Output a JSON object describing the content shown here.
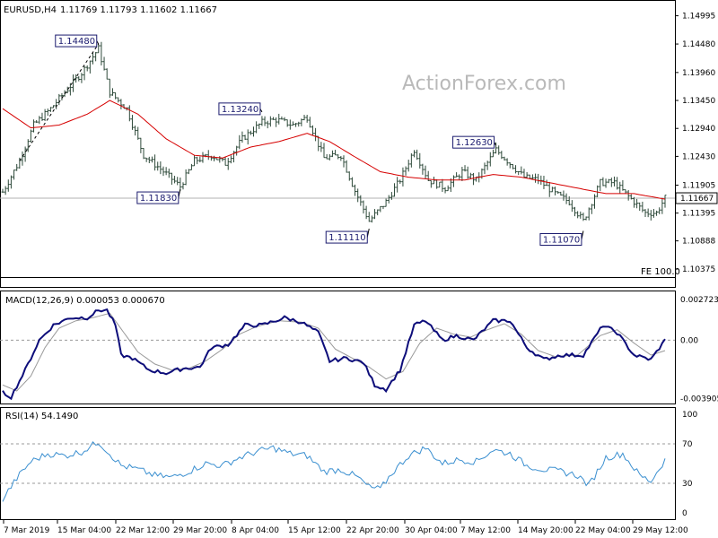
{
  "header": {
    "symbol": "EURUSD,H4",
    "ohlc": "1.11769 1.11793 1.11602 1.11667"
  },
  "watermark": "ActionForex.com",
  "fe_label": "FE 100.0",
  "colors": {
    "bars": "#2e4a3a",
    "ma": "#d60000",
    "macd_main": "#0d0d7a",
    "macd_signal": "#999999",
    "rsi": "#3a8fd0",
    "frame": "#000000",
    "label_border": "#1a1a6e"
  },
  "chart_data": [
    {
      "type": "ohlc",
      "panel": "price",
      "ylim": [
        1.10375,
        1.1525
      ],
      "y_ticks": [
        "1.14995",
        "1.14480",
        "1.13960",
        "1.13450",
        "1.12940",
        "1.12430",
        "1.11905",
        "1.11395",
        "1.10888",
        "1.10375"
      ],
      "current_price_label": "1.11667",
      "current_price": 1.11667,
      "annotations": [
        {
          "text": "1.14480",
          "value": 1.1448,
          "bar": 34
        },
        {
          "text": "1.13240",
          "value": 1.1324,
          "bar": 92
        },
        {
          "text": "1.11830",
          "value": 1.1183,
          "bar": 63
        },
        {
          "text": "1.11110",
          "value": 1.1111,
          "bar": 130
        },
        {
          "text": "1.12630",
          "value": 1.1263,
          "bar": 175
        },
        {
          "text": "1.11070",
          "value": 1.1107,
          "bar": 206
        }
      ],
      "close_anchors": [
        [
          0,
          1.1178
        ],
        [
          6,
          1.1235
        ],
        [
          11,
          1.13
        ],
        [
          17,
          1.133
        ],
        [
          22,
          1.136
        ],
        [
          28,
          1.1395
        ],
        [
          34,
          1.144
        ],
        [
          38,
          1.136
        ],
        [
          44,
          1.133
        ],
        [
          50,
          1.1245
        ],
        [
          56,
          1.122
        ],
        [
          63,
          1.1188
        ],
        [
          68,
          1.1235
        ],
        [
          74,
          1.1245
        ],
        [
          79,
          1.123
        ],
        [
          85,
          1.1275
        ],
        [
          92,
          1.1305
        ],
        [
          97,
          1.131
        ],
        [
          103,
          1.13
        ],
        [
          108,
          1.1315
        ],
        [
          114,
          1.124
        ],
        [
          120,
          1.1245
        ],
        [
          125,
          1.118
        ],
        [
          130,
          1.1125
        ],
        [
          136,
          1.116
        ],
        [
          141,
          1.12
        ],
        [
          146,
          1.1255
        ],
        [
          151,
          1.12
        ],
        [
          157,
          1.1185
        ],
        [
          163,
          1.1215
        ],
        [
          168,
          1.12
        ],
        [
          175,
          1.1255
        ],
        [
          180,
          1.123
        ],
        [
          185,
          1.1205
        ],
        [
          190,
          1.12
        ],
        [
          196,
          1.1175
        ],
        [
          201,
          1.116
        ],
        [
          206,
          1.1125
        ],
        [
          212,
          1.1195
        ],
        [
          217,
          1.1195
        ],
        [
          223,
          1.1165
        ],
        [
          228,
          1.114
        ],
        [
          232,
          1.114
        ],
        [
          235,
          1.1167
        ]
      ],
      "ma_anchors": [
        [
          0,
          1.133
        ],
        [
          10,
          1.1295
        ],
        [
          20,
          1.13
        ],
        [
          30,
          1.132
        ],
        [
          38,
          1.1345
        ],
        [
          48,
          1.132
        ],
        [
          58,
          1.1275
        ],
        [
          68,
          1.1245
        ],
        [
          78,
          1.124
        ],
        [
          88,
          1.126
        ],
        [
          98,
          1.127
        ],
        [
          108,
          1.1285
        ],
        [
          116,
          1.127
        ],
        [
          124,
          1.1245
        ],
        [
          134,
          1.1215
        ],
        [
          144,
          1.1205
        ],
        [
          154,
          1.12
        ],
        [
          164,
          1.12
        ],
        [
          174,
          1.121
        ],
        [
          184,
          1.1205
        ],
        [
          194,
          1.1195
        ],
        [
          204,
          1.1185
        ],
        [
          214,
          1.1175
        ],
        [
          224,
          1.1175
        ],
        [
          235,
          1.1165
        ]
      ]
    },
    {
      "type": "line",
      "panel": "macd",
      "title": "MACD(12,26,9) 0.000053 0.000670",
      "ylim": [
        -0.004,
        0.0029
      ],
      "y_ticks": [
        "0.002723",
        "0.00",
        "-0.003905"
      ],
      "main_anchors": [
        [
          0,
          -0.0035
        ],
        [
          3,
          -0.0038
        ],
        [
          8,
          -0.002
        ],
        [
          13,
          0.0
        ],
        [
          18,
          0.001
        ],
        [
          24,
          0.0015
        ],
        [
          30,
          0.0015
        ],
        [
          34,
          0.002
        ],
        [
          37,
          0.002
        ],
        [
          40,
          0.001
        ],
        [
          42,
          -0.001
        ],
        [
          46,
          -0.0012
        ],
        [
          52,
          -0.002
        ],
        [
          58,
          -0.0022
        ],
        [
          64,
          -0.0019
        ],
        [
          70,
          -0.0018
        ],
        [
          74,
          -0.0005
        ],
        [
          80,
          -0.0003
        ],
        [
          86,
          0.001
        ],
        [
          92,
          0.001
        ],
        [
          100,
          0.0015
        ],
        [
          106,
          0.0012
        ],
        [
          112,
          0.0005
        ],
        [
          116,
          -0.0014
        ],
        [
          122,
          -0.0012
        ],
        [
          128,
          -0.0015
        ],
        [
          132,
          -0.003
        ],
        [
          136,
          -0.0033
        ],
        [
          141,
          -0.002
        ],
        [
          146,
          0.001
        ],
        [
          150,
          0.0013
        ],
        [
          156,
          0.0
        ],
        [
          161,
          0.0003
        ],
        [
          167,
          0.0
        ],
        [
          174,
          0.0013
        ],
        [
          180,
          0.0013
        ],
        [
          186,
          -0.0005
        ],
        [
          192,
          -0.0013
        ],
        [
          198,
          -0.001
        ],
        [
          206,
          -0.001
        ],
        [
          213,
          0.001
        ],
        [
          218,
          0.0005
        ],
        [
          224,
          -0.001
        ],
        [
          230,
          -0.0013
        ],
        [
          235,
          0.0
        ]
      ],
      "signal_anchors": [
        [
          0,
          -0.003
        ],
        [
          5,
          -0.0034
        ],
        [
          10,
          -0.0024
        ],
        [
          15,
          -0.0005
        ],
        [
          20,
          0.0008
        ],
        [
          26,
          0.0013
        ],
        [
          32,
          0.0015
        ],
        [
          38,
          0.0018
        ],
        [
          43,
          0.0005
        ],
        [
          48,
          -0.0008
        ],
        [
          54,
          -0.0016
        ],
        [
          60,
          -0.002
        ],
        [
          66,
          -0.0019
        ],
        [
          72,
          -0.0014
        ],
        [
          78,
          -0.0006
        ],
        [
          84,
          0.0004
        ],
        [
          90,
          0.0009
        ],
        [
          98,
          0.0013
        ],
        [
          106,
          0.0012
        ],
        [
          112,
          0.0008
        ],
        [
          118,
          -0.0006
        ],
        [
          124,
          -0.0012
        ],
        [
          130,
          -0.0018
        ],
        [
          136,
          -0.0026
        ],
        [
          142,
          -0.0021
        ],
        [
          148,
          -0.0002
        ],
        [
          154,
          0.0008
        ],
        [
          160,
          0.0004
        ],
        [
          166,
          0.0002
        ],
        [
          172,
          0.0007
        ],
        [
          178,
          0.0011
        ],
        [
          184,
          0.0004
        ],
        [
          190,
          -0.0007
        ],
        [
          196,
          -0.0011
        ],
        [
          204,
          -0.001
        ],
        [
          212,
          0.0003
        ],
        [
          218,
          0.0007
        ],
        [
          224,
          -0.0002
        ],
        [
          230,
          -0.001
        ],
        [
          235,
          -0.0007
        ]
      ]
    },
    {
      "type": "line",
      "panel": "rsi",
      "title": "RSI(14) 54.1490",
      "ylim": [
        0,
        100
      ],
      "y_ticks": [
        "100",
        "70",
        "30",
        "0"
      ],
      "levels": [
        70,
        30
      ],
      "anchors": [
        [
          0,
          14
        ],
        [
          5,
          35
        ],
        [
          10,
          52
        ],
        [
          16,
          60
        ],
        [
          22,
          58
        ],
        [
          28,
          62
        ],
        [
          34,
          72
        ],
        [
          38,
          60
        ],
        [
          42,
          48
        ],
        [
          48,
          44
        ],
        [
          54,
          38
        ],
        [
          60,
          36
        ],
        [
          66,
          42
        ],
        [
          72,
          50
        ],
        [
          78,
          48
        ],
        [
          84,
          56
        ],
        [
          90,
          62
        ],
        [
          96,
          66
        ],
        [
          102,
          60
        ],
        [
          108,
          58
        ],
        [
          114,
          42
        ],
        [
          120,
          44
        ],
        [
          126,
          36
        ],
        [
          130,
          26
        ],
        [
          134,
          24
        ],
        [
          138,
          40
        ],
        [
          144,
          58
        ],
        [
          150,
          66
        ],
        [
          156,
          50
        ],
        [
          162,
          54
        ],
        [
          168,
          52
        ],
        [
          174,
          64
        ],
        [
          180,
          60
        ],
        [
          186,
          48
        ],
        [
          192,
          44
        ],
        [
          198,
          42
        ],
        [
          204,
          38
        ],
        [
          208,
          28
        ],
        [
          214,
          56
        ],
        [
          220,
          60
        ],
        [
          226,
          38
        ],
        [
          230,
          32
        ],
        [
          235,
          54
        ]
      ]
    }
  ],
  "x_axis": {
    "labels": [
      "7 Mar 2019",
      "15 Mar 04:00",
      "22 Mar 12:00",
      "29 Mar 20:00",
      "8 Apr 04:00",
      "15 Apr 12:00",
      "22 Apr 20:00",
      "30 Apr 04:00",
      "7 May 12:00",
      "14 May 20:00",
      "22 May 04:00",
      "29 May 12:00"
    ]
  }
}
